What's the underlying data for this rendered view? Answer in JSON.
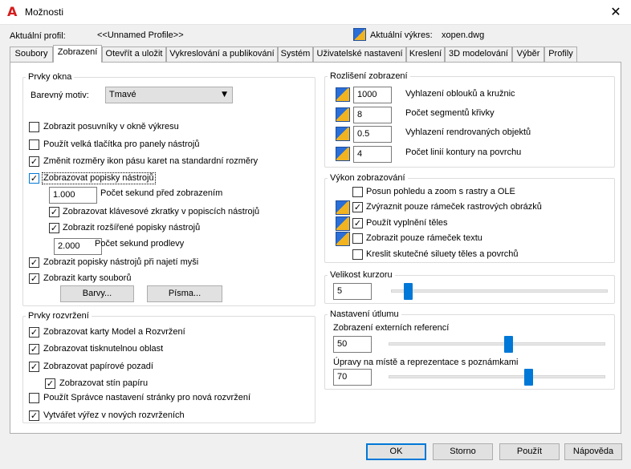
{
  "window": {
    "title": "Možnosti",
    "close_glyph": "✕"
  },
  "header": {
    "profile_label": "Aktuální profil:",
    "profile_value": "<<Unnamed Profile>>",
    "drawing_label": "Aktuální výkres:",
    "drawing_value": "xopen.dwg"
  },
  "tabs": [
    "Soubory",
    "Zobrazení",
    "Otevřít a uložit",
    "Vykreslování a publikování",
    "Systém",
    "Uživatelské nastavení",
    "Kreslení",
    "3D modelování",
    "Výběr",
    "Profily"
  ],
  "active_tab": "Zobrazení",
  "window_elements": {
    "group_label": "Prvky okna",
    "color_theme_label": "Barevný motiv:",
    "color_theme_value": "Tmavé",
    "opt_scrollbars": "Zobrazit posuvníky v okně výkresu",
    "opt_large_buttons": "Použít velká tlačítka pro panely nástrojů",
    "opt_resize_ribbon": "Změnit rozměry ikon pásu karet na standardní rozměry",
    "opt_tooltips": "Zobrazovat popisky nástrojů",
    "tooltip_delay_value": "1.000",
    "tooltip_delay_label": "Počet sekund před zobrazením",
    "opt_shortcut_keys": "Zobrazovat klávesové zkratky v popiscích nástrojů",
    "opt_extended_tooltips": "Zobrazit rozšířené popisky nástrojů",
    "extended_delay_value": "2.000",
    "extended_delay_label": "Počet sekund prodlevy",
    "opt_rollover": "Zobrazit popisky nástrojů při najetí myši",
    "opt_file_tabs": "Zobrazit karty souborů",
    "colors_button": "Barvy...",
    "fonts_button": "Písma..."
  },
  "layout_elements": {
    "group_label": "Prvky rozvržení",
    "opt_model_tabs": "Zobrazovat karty Model a Rozvržení",
    "opt_printable": "Zobrazovat tisknutelnou oblast",
    "opt_paper_bg": "Zobrazovat papírové pozadí",
    "opt_paper_shadow": "Zobrazovat stín papíru",
    "opt_page_setup": "Použít Správce nastavení stránky pro nová rozvržení",
    "opt_viewport": "Vytvářet výřez v nových rozvrženích"
  },
  "resolution": {
    "group_label": "Rozlišení zobrazení",
    "arc_value": "1000",
    "arc_label": "Vyhlazení oblouků a kružnic",
    "segments_value": "8",
    "segments_label": "Počet segmentů křivky",
    "render_value": "0.5",
    "render_label": "Vyhlazení rendrovaných objektů",
    "contour_value": "4",
    "contour_label": "Počet linií kontury na povrchu"
  },
  "performance": {
    "group_label": "Výkon zobrazování",
    "opt_pan_zoom": "Posun pohledu a zoom s rastry a OLE",
    "opt_highlight_raster": "Zvýraznit pouze rámeček rastrových obrázků",
    "opt_solid_fill": "Použít vyplnění těles",
    "opt_text_frame": "Zobrazit pouze rámeček textu",
    "opt_silhouettes": "Kreslit skutečné siluety těles a povrchů"
  },
  "crosshair": {
    "group_label": "Velikost kurzoru",
    "value": "5",
    "max": 100
  },
  "fade": {
    "group_label": "Nastavení útlumu",
    "xref_label": "Zobrazení externích referencí",
    "xref_value": "50",
    "inplace_label": "Úpravy na místě a reprezentace s poznámkami",
    "inplace_value": "70",
    "max": 90
  },
  "buttons": {
    "ok": "OK",
    "cancel": "Storno",
    "apply": "Použít",
    "help": "Nápověda"
  },
  "colors": {
    "accent": "#0078d7",
    "app_icon": "#d41c1c"
  }
}
